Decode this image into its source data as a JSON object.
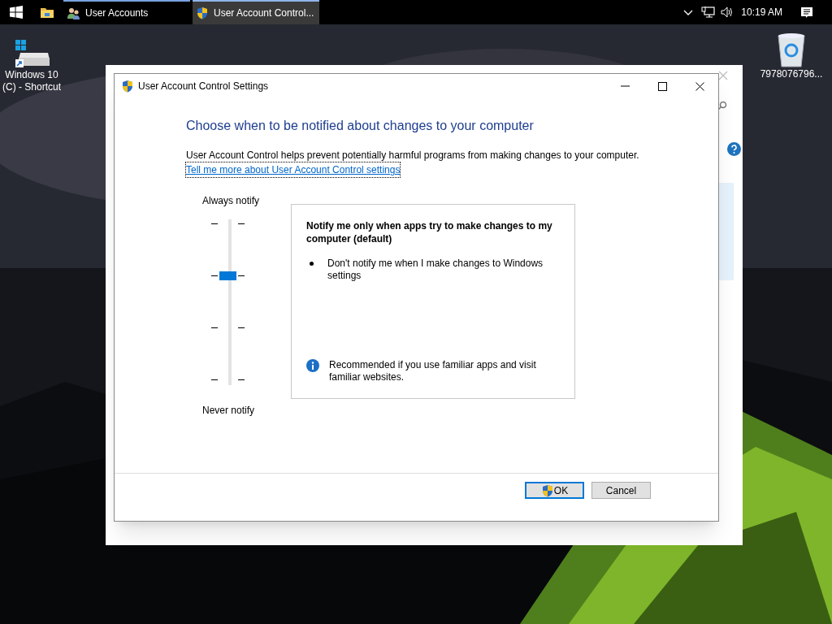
{
  "taskbar": {
    "apps": [
      {
        "label": "User Accounts",
        "kind": "users",
        "selected": false
      },
      {
        "label": "User Account Control...",
        "kind": "shield",
        "selected": true
      }
    ],
    "time": "10:19 AM"
  },
  "desktop_icons": [
    {
      "label": "Windows 10 (C) - Shortcut",
      "kind": "drive"
    },
    {
      "label": "7978076796...",
      "kind": "bin"
    }
  ],
  "dialog": {
    "title": "User Account Control Settings",
    "heading": "Choose when to be notified about changes to your computer",
    "description": "User Account Control helps prevent potentially harmful programs from making changes to your computer.",
    "link": "Tell me more about User Account Control settings",
    "slider": {
      "top_label": "Always notify",
      "bottom_label": "Never notify",
      "level": 0.667
    },
    "info_box": {
      "title": "Notify me only when apps try to make changes to my computer (default)",
      "bullets": [
        "Don't notify me when I make changes to Windows settings"
      ],
      "note": "Recommended if you use familiar apps and visit familiar websites."
    },
    "buttons": [
      {
        "label": "OK",
        "default": true
      },
      {
        "label": "Cancel",
        "default": false
      }
    ]
  }
}
